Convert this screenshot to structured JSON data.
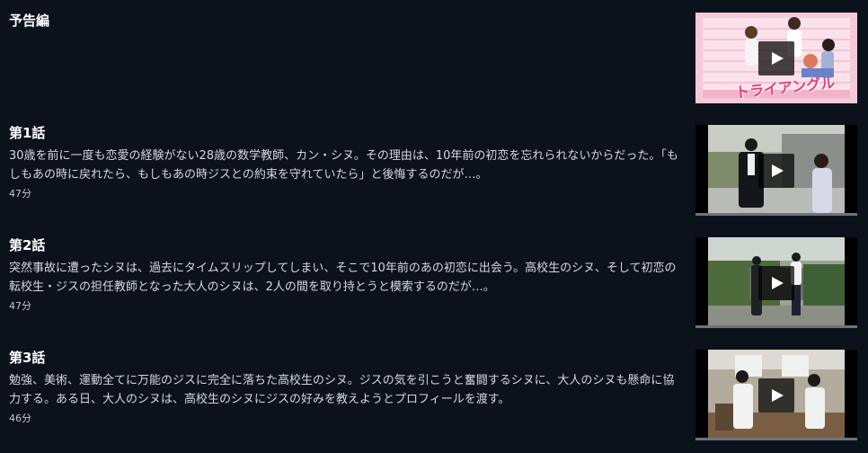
{
  "episodes": [
    {
      "title": "予告編",
      "description": "",
      "duration": "",
      "thumb_overlay_text": "トライアングル",
      "progress": null
    },
    {
      "title": "第1話",
      "description": "30歳を前に一度も恋愛の経験がない28歳の数学教師、カン・シヌ。その理由は、10年前の初恋を忘れられないからだった。「もしもあの時に戻れたら、もしもあの時ジスとの約束を守れていたら」と後悔するのだが…。",
      "duration": "47分",
      "progress": 0.0
    },
    {
      "title": "第2話",
      "description": "突然事故に遭ったシヌは、過去にタイムスリップしてしまい、そこで10年前のあの初恋に出会う。高校生のシヌ、そして初恋の転校生・ジスの担任教師となった大人のシヌは、2人の間を取り持とうと模索するのだが…。",
      "duration": "47分",
      "progress": 0.0
    },
    {
      "title": "第3話",
      "description": "勉強、美術、運動全てに万能のジスに完全に落ちた高校生のシヌ。ジスの気を引こうと奮闘するシヌに、大人のシヌも懸命に協力する。ある日、大人のシヌは、高校生のシヌにジスの好みを教えようとプロフィールを渡す。",
      "duration": "46分",
      "progress": 0.0
    }
  ],
  "icons": {
    "play": "play-icon"
  },
  "colors": {
    "background": "#0b121c",
    "progress_track": "#6e737b"
  }
}
